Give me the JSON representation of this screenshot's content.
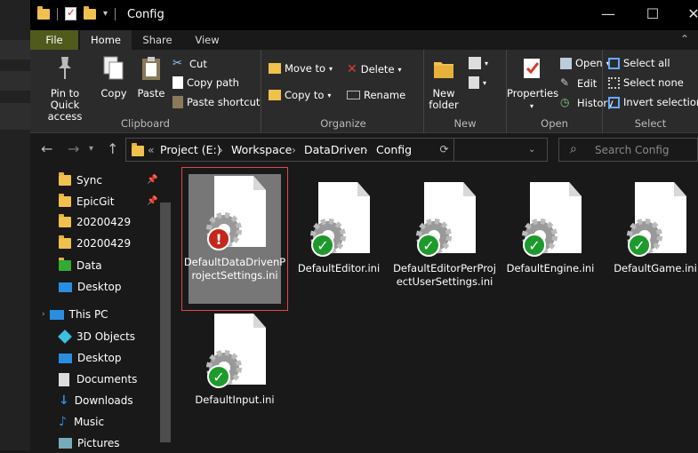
{
  "window": {
    "title": "Config",
    "minimize": "—",
    "maximize": "☐",
    "close": "✕"
  },
  "tabs": [
    {
      "label": "File"
    },
    {
      "label": "Home"
    },
    {
      "label": "Share"
    },
    {
      "label": "View"
    }
  ],
  "ribbon": {
    "clipboard": {
      "label": "Clipboard",
      "pin": "Pin to Quick access",
      "copy": "Copy",
      "paste": "Paste",
      "cut": "Cut",
      "copy_path": "Copy path",
      "paste_shortcut": "Paste shortcut"
    },
    "organize": {
      "label": "Organize",
      "move_to": "Move to",
      "copy_to": "Copy to",
      "delete": "Delete",
      "rename": "Rename"
    },
    "new": {
      "label": "New",
      "new_folder": "New folder"
    },
    "open": {
      "label": "Open",
      "properties": "Properties",
      "open": "Open",
      "edit": "Edit",
      "history": "History"
    },
    "select": {
      "label": "Select",
      "select_all": "Select all",
      "select_none": "Select none",
      "invert": "Invert selection"
    }
  },
  "address": {
    "prefix": "«",
    "crumbs": [
      "Project (E:)",
      "Workspace",
      "DataDriven",
      "Config"
    ],
    "search_placeholder": "Search Config"
  },
  "sidebar": {
    "items": [
      {
        "label": "Sync",
        "pinned": true,
        "icon": "folder-icon"
      },
      {
        "label": "EpicGit",
        "pinned": true,
        "icon": "folder-icon"
      },
      {
        "label": "20200429",
        "icon": "folder-icon"
      },
      {
        "label": "20200429",
        "icon": "folder-icon"
      },
      {
        "label": "Data",
        "icon": "folder-sync-icon"
      },
      {
        "label": "Desktop",
        "icon": "desktop-icon"
      },
      {
        "label": "This PC",
        "icon": "pc-icon"
      },
      {
        "label": "3D Objects",
        "icon": "cube-icon"
      },
      {
        "label": "Desktop",
        "icon": "desktop-icon"
      },
      {
        "label": "Documents",
        "icon": "documents-icon"
      },
      {
        "label": "Downloads",
        "icon": "download-icon"
      },
      {
        "label": "Music",
        "icon": "music-icon"
      },
      {
        "label": "Pictures",
        "icon": "pictures-icon"
      }
    ]
  },
  "files": [
    {
      "name": "DefaultDataDrivenProjectSettings.ini",
      "status": "error",
      "selected": true
    },
    {
      "name": "DefaultEditor.ini",
      "status": "ok"
    },
    {
      "name": "DefaultEditorPerProjectUserSettings.ini",
      "status": "ok"
    },
    {
      "name": "DefaultEngine.ini",
      "status": "ok"
    },
    {
      "name": "DefaultGame.ini",
      "status": "ok"
    },
    {
      "name": "DefaultInput.ini",
      "status": "ok"
    }
  ],
  "colors": {
    "file_tab": "#4f5a1c",
    "selection_border": "#e04848",
    "ok_badge": "#1d9a2b",
    "error_badge": "#c4271c"
  }
}
